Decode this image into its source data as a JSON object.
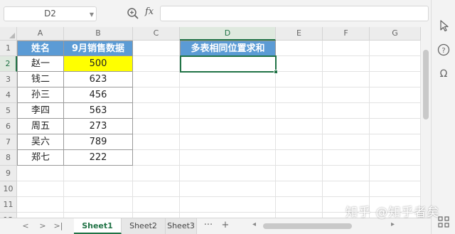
{
  "formula_bar": {
    "name_box": "D2",
    "fx_label": "fx",
    "formula_value": ""
  },
  "columns": [
    "A",
    "B",
    "C",
    "D",
    "E",
    "F",
    "G"
  ],
  "active_column": "D",
  "rows": [
    "1",
    "2",
    "3",
    "4",
    "5",
    "6",
    "7",
    "8",
    "9",
    "10",
    "11",
    "12",
    "13"
  ],
  "active_row": "2",
  "table": {
    "header_name": "姓名",
    "header_sales": "9月销售数据",
    "records": [
      {
        "name": "赵一",
        "sales": "500"
      },
      {
        "name": "钱二",
        "sales": "623"
      },
      {
        "name": "孙三",
        "sales": "456"
      },
      {
        "name": "李四",
        "sales": "563"
      },
      {
        "name": "周五",
        "sales": "273"
      },
      {
        "name": "吴六",
        "sales": "789"
      },
      {
        "name": "郑七",
        "sales": "222"
      }
    ]
  },
  "sum_header": "多表相同位置求和",
  "sum_value": "",
  "tabs": [
    {
      "label": "Sheet1",
      "active": true
    },
    {
      "label": "Sheet2",
      "active": false
    },
    {
      "label": "Sheet3",
      "active": false
    }
  ],
  "tab_more": "···",
  "tab_add": "+",
  "watermark": "知乎 @知乎者矣",
  "colors": {
    "header_fill": "#5b9bd5",
    "highlight_fill": "#ffff00",
    "accent": "#217346"
  },
  "icons": [
    "search-zoom-icon",
    "cursor-icon",
    "help-icon",
    "omega-icon",
    "grid-apps-icon"
  ]
}
